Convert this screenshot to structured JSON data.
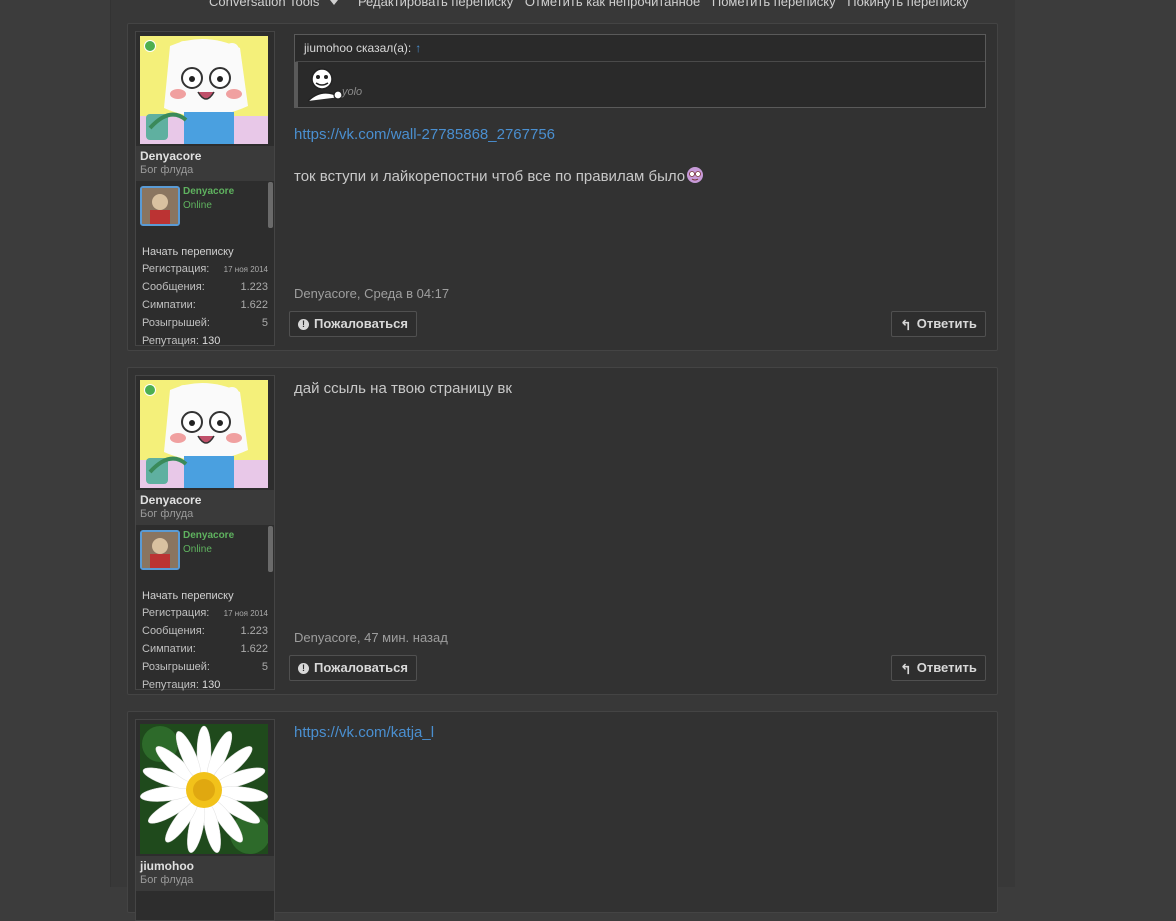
{
  "toolbar": {
    "conversation_tools": "Conversation Tools",
    "edit": "Редактировать переписку",
    "mark_unread": "Отметить как непрочитанное",
    "star": "Пометить переписку",
    "leave": "Покинуть переписку"
  },
  "posts": [
    {
      "user": {
        "name": "Denyacore",
        "title": "Бог флуда",
        "mini_name": "Denyacore",
        "mini_status": "Online",
        "start_conv": "Начать переписку",
        "reg_label": "Регистрация:",
        "reg_value": "17 ноя 2014",
        "msg_label": "Сообщения:",
        "msg_value": "1.223",
        "likes_label": "Симпатии:",
        "likes_value": "1.622",
        "giveaways_label": "Розыгрышей:",
        "giveaways_value": "5",
        "rep_label": "Репутация:",
        "rep_value": "130"
      },
      "quote": {
        "author": "jiumohoo сказал(а):",
        "arrow": "↑",
        "text": "yolo"
      },
      "link": "https://vk.com/wall-27785868_2767756",
      "message": "ток вступи и лайкорепостни чтоб все по правилам было",
      "meta": "Denyacore, Среда в 04:17",
      "report": "Пожаловаться",
      "reply": "Ответить"
    },
    {
      "user": {
        "name": "Denyacore",
        "title": "Бог флуда",
        "mini_name": "Denyacore",
        "mini_status": "Online",
        "start_conv": "Начать переписку",
        "reg_label": "Регистрация:",
        "reg_value": "17 ноя 2014",
        "msg_label": "Сообщения:",
        "msg_value": "1.223",
        "likes_label": "Симпатии:",
        "likes_value": "1.622",
        "giveaways_label": "Розыгрышей:",
        "giveaways_value": "5",
        "rep_label": "Репутация:",
        "rep_value": "130"
      },
      "message": "дай ссыль на твою страницу вк",
      "meta": "Denyacore, 47 мин. назад",
      "report": "Пожаловаться",
      "reply": "Ответить"
    },
    {
      "user": {
        "name": "jiumohoo",
        "title": "Бог флуда"
      },
      "link": "https://vk.com/katja_l"
    }
  ],
  "colors": {
    "link": "#4a8fd0",
    "online": "#5fb25f"
  },
  "icons": [
    "exclamation-circle-icon",
    "reply-icon",
    "caret-down-icon",
    "emoji-icon",
    "meme-face-icon"
  ]
}
